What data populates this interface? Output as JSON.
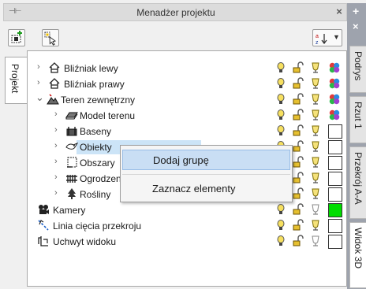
{
  "window": {
    "title": "Menadżer projektu",
    "pin_glyph": "⊣⊢",
    "close_glyph": "×"
  },
  "tabs": {
    "left": "Projekt",
    "right": [
      "Podrys",
      "Rzut 1",
      "Przekrój A-A",
      "Widok 3D"
    ],
    "right_add": "+",
    "right_close": "×"
  },
  "tree": [
    {
      "label": "Bliźniak lewy",
      "arrow": "›",
      "icon": "house-outline-icon",
      "swatch": "multicolor"
    },
    {
      "label": "Bliźniak prawy",
      "arrow": "›",
      "icon": "house-outline-icon",
      "swatch": "multicolor"
    },
    {
      "label": "Teren zewnętrzny",
      "arrow": "⌄",
      "icon": "terrain-icon",
      "swatch": "multicolor"
    },
    {
      "label": "Model terenu",
      "arrow": "›",
      "icon": "terrain-model-icon",
      "swatch": "multicolor"
    },
    {
      "label": "Baseny",
      "arrow": "›",
      "icon": "pool-icon",
      "swatch": "empty"
    },
    {
      "label": "Obiekty",
      "arrow": "›",
      "icon": "objects-icon",
      "swatch": "empty",
      "selected": true
    },
    {
      "label": "Obszary",
      "arrow": "›",
      "icon": "area-icon",
      "swatch": "empty"
    },
    {
      "label": "Ogrodzenia",
      "arrow": "›",
      "icon": "fence-icon",
      "swatch": "empty"
    },
    {
      "label": "Rośliny",
      "arrow": "›",
      "icon": "tree-icon",
      "swatch": "empty"
    },
    {
      "label": "Kamery",
      "arrow": "",
      "icon": "camera-icon",
      "swatch": "green"
    },
    {
      "label": "Linia cięcia przekroju",
      "arrow": "",
      "icon": "section-line-icon",
      "swatch": "empty"
    },
    {
      "label": "Uchwyt widoku",
      "arrow": "",
      "icon": "view-handle-icon",
      "swatch": "empty"
    }
  ],
  "context_menu": {
    "items": [
      "Dodaj grupę",
      "Zaznacz elementy"
    ]
  },
  "colors": {
    "selection": "#cce4f7",
    "menu_highlight": "#c9def4",
    "green_swatch": "#00dd00",
    "strip": "#9ea3ad"
  }
}
